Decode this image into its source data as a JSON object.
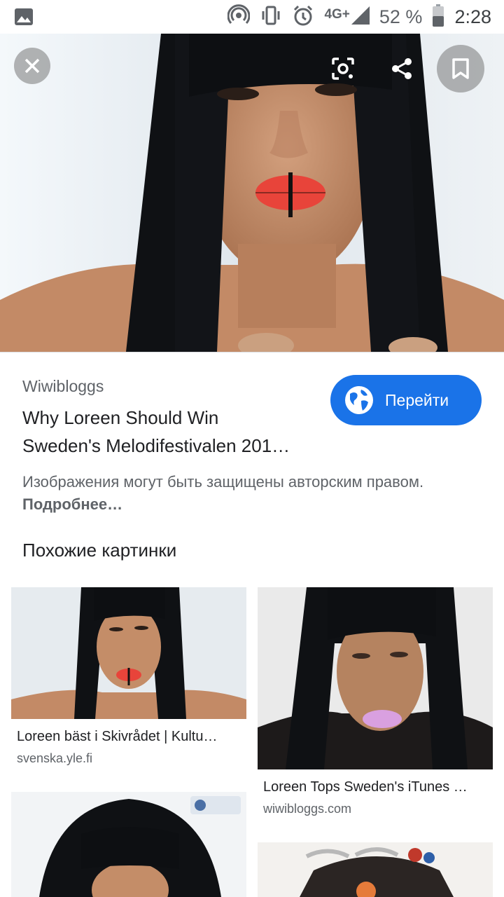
{
  "status_bar": {
    "network": "4G+",
    "battery": "52 %",
    "time": "2:28"
  },
  "hero": {
    "close_label": "close",
    "icons": [
      "close-icon",
      "lens-icon",
      "share-icon",
      "bookmark-icon"
    ]
  },
  "result": {
    "source": "Wiwibloggs",
    "title_line1": "Why Loreen Should Win",
    "title_line2": "Sweden's Melodifestivalen 201…",
    "visit_label": "Перейти",
    "copyright_text": "Изображения могут быть защищены авторским правом. ",
    "copyright_link": "Подробнее…"
  },
  "similar": {
    "heading": "Похожие картинки",
    "items": [
      {
        "title": "Loreen bäst i Skivrådet | Kultu…",
        "source": "svenska.yle.fi"
      },
      {
        "title": "Loreen Tops Sweden's iTunes …",
        "source": "wiwibloggs.com"
      },
      {
        "title": "",
        "source": ""
      },
      {
        "title": "",
        "source": ""
      }
    ]
  },
  "colors": {
    "accent": "#1a73e8",
    "hair": "#0f1114",
    "skin": "#c99672",
    "lips_red": "#e8443a",
    "lips_pink": "#d9a0e0"
  }
}
